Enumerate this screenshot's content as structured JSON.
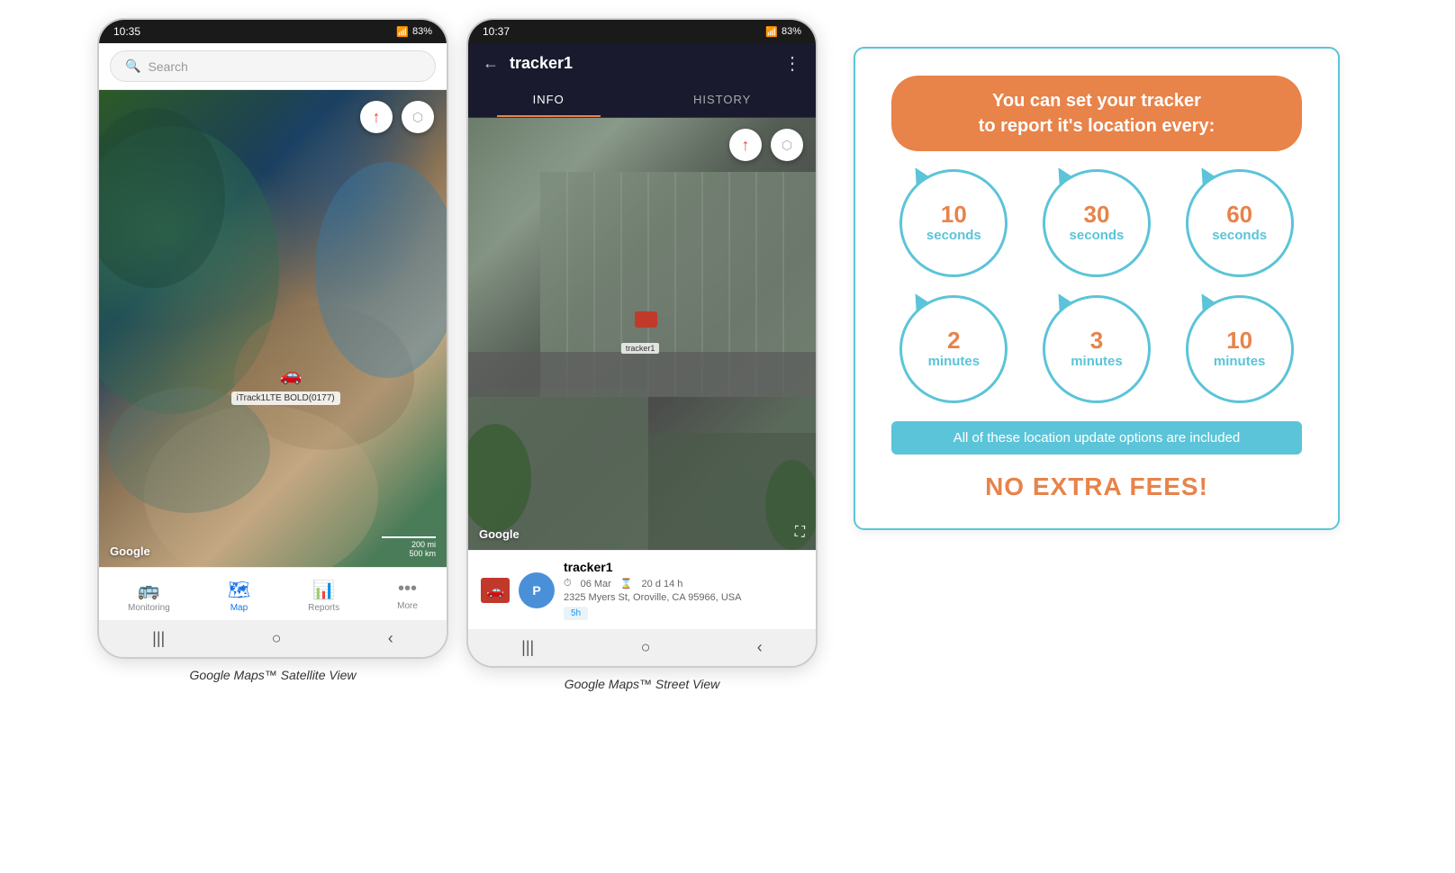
{
  "phone1": {
    "status_time": "10:35",
    "battery": "83%",
    "search_placeholder": "Search",
    "compass_icon": "🧭",
    "navigate_icon": "➤",
    "tracker_label": "iTrack1LTE BOLD(0177)",
    "google_logo": "Google",
    "scale_200mi": "200 mi",
    "scale_500km": "500 km",
    "nav_items": [
      {
        "icon": "🚌",
        "label": "Monitoring",
        "active": false
      },
      {
        "icon": "🗺",
        "label": "Map",
        "active": true
      },
      {
        "icon": "📊",
        "label": "Reports",
        "active": false
      },
      {
        "icon": "•••",
        "label": "More",
        "active": false
      }
    ],
    "caption": "Google Maps™ Satellite View"
  },
  "phone2": {
    "status_time": "10:37",
    "battery": "83%",
    "back_icon": "←",
    "tracker_title": "tracker1",
    "more_icon": "⋮",
    "tabs": [
      {
        "label": "INFO",
        "active": true
      },
      {
        "label": "HISTORY",
        "active": false
      }
    ],
    "compass_icon": "🧭",
    "navigate_icon": "➤",
    "tracker_car_label": "tracker1",
    "google_logo": "Google",
    "expand_icon": "⛶",
    "tracker_name": "tracker1",
    "tracker_date": "06 Mar",
    "tracker_duration": "20 d 14 h",
    "tracker_address": "2325 Myers St, Oroville, CA 95966, USA",
    "time_badge": "5h",
    "caption": "Google Maps™ Street View"
  },
  "info_panel": {
    "headline_line1": "You can set your tracker",
    "headline_line2": "to report it's location every:",
    "intervals": [
      {
        "number": "10",
        "unit": "seconds"
      },
      {
        "number": "30",
        "unit": "seconds"
      },
      {
        "number": "60",
        "unit": "seconds"
      },
      {
        "number": "2",
        "unit": "minutes"
      },
      {
        "number": "3",
        "unit": "minutes"
      },
      {
        "number": "10",
        "unit": "minutes"
      }
    ],
    "no_extra_banner": "All of these location update options are included",
    "no_extra_fees": "NO EXTRA FEES!"
  }
}
